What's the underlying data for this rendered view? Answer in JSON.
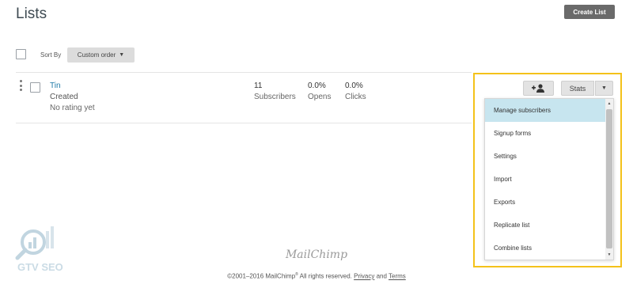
{
  "header": {
    "title": "Lists",
    "create_label": "Create List"
  },
  "toolbar": {
    "sort_label": "Sort By",
    "sort_value": "Custom order"
  },
  "list_row": {
    "name": "Tin",
    "created": "Created",
    "rating": "No rating yet",
    "stats": [
      {
        "value": "11",
        "label": "Subscribers"
      },
      {
        "value": "0.0%",
        "label": "Opens"
      },
      {
        "value": "0.0%",
        "label": "Clicks"
      }
    ],
    "stats_button": "Stats"
  },
  "dropdown": {
    "items": [
      {
        "label": "Manage subscribers",
        "active": true
      },
      {
        "label": "Signup forms",
        "active": false
      },
      {
        "label": "Settings",
        "active": false
      },
      {
        "label": "Import",
        "active": false
      },
      {
        "label": "Exports",
        "active": false
      },
      {
        "label": "Replicate list",
        "active": false
      },
      {
        "label": "Combine lists",
        "active": false
      }
    ]
  },
  "footer": {
    "logo_text": "MailChimp",
    "copyright_pre": "©2001–2016 MailChimp",
    "registered": "®",
    "rights": " All rights reserved. ",
    "privacy": "Privacy",
    "and": " and ",
    "terms": "Terms"
  },
  "watermark": {
    "text": "GTV SEO"
  },
  "colors": {
    "accent_link": "#1f7aa8",
    "highlight": "#f4c21a",
    "menu_active": "#c7e5ef",
    "primary_button": "#6a6a6a"
  }
}
